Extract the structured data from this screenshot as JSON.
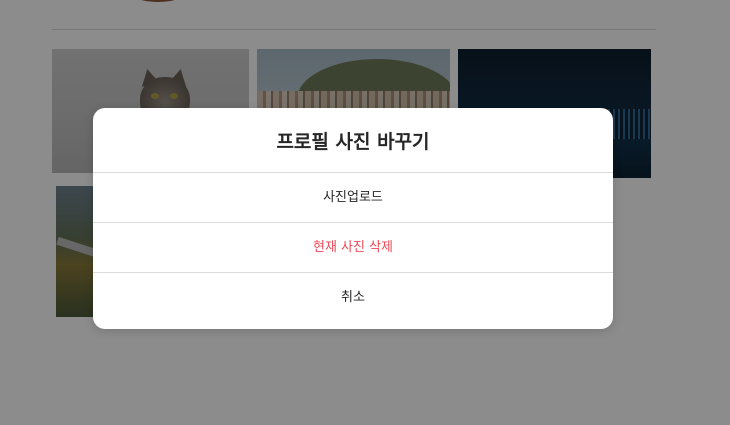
{
  "modal": {
    "title": "프로필 사진 바꾸기",
    "upload_label": "사진업로드",
    "remove_label": "현재 사진 삭제",
    "cancel_label": "취소"
  },
  "colors": {
    "danger": "#ed4956",
    "text": "#262626",
    "divider": "#dbdbdb",
    "overlay": "rgba(0,0,0,0.45)"
  },
  "gallery": {
    "photos": [
      "cat",
      "hillside-village",
      "night-city",
      "mountain-road"
    ]
  }
}
